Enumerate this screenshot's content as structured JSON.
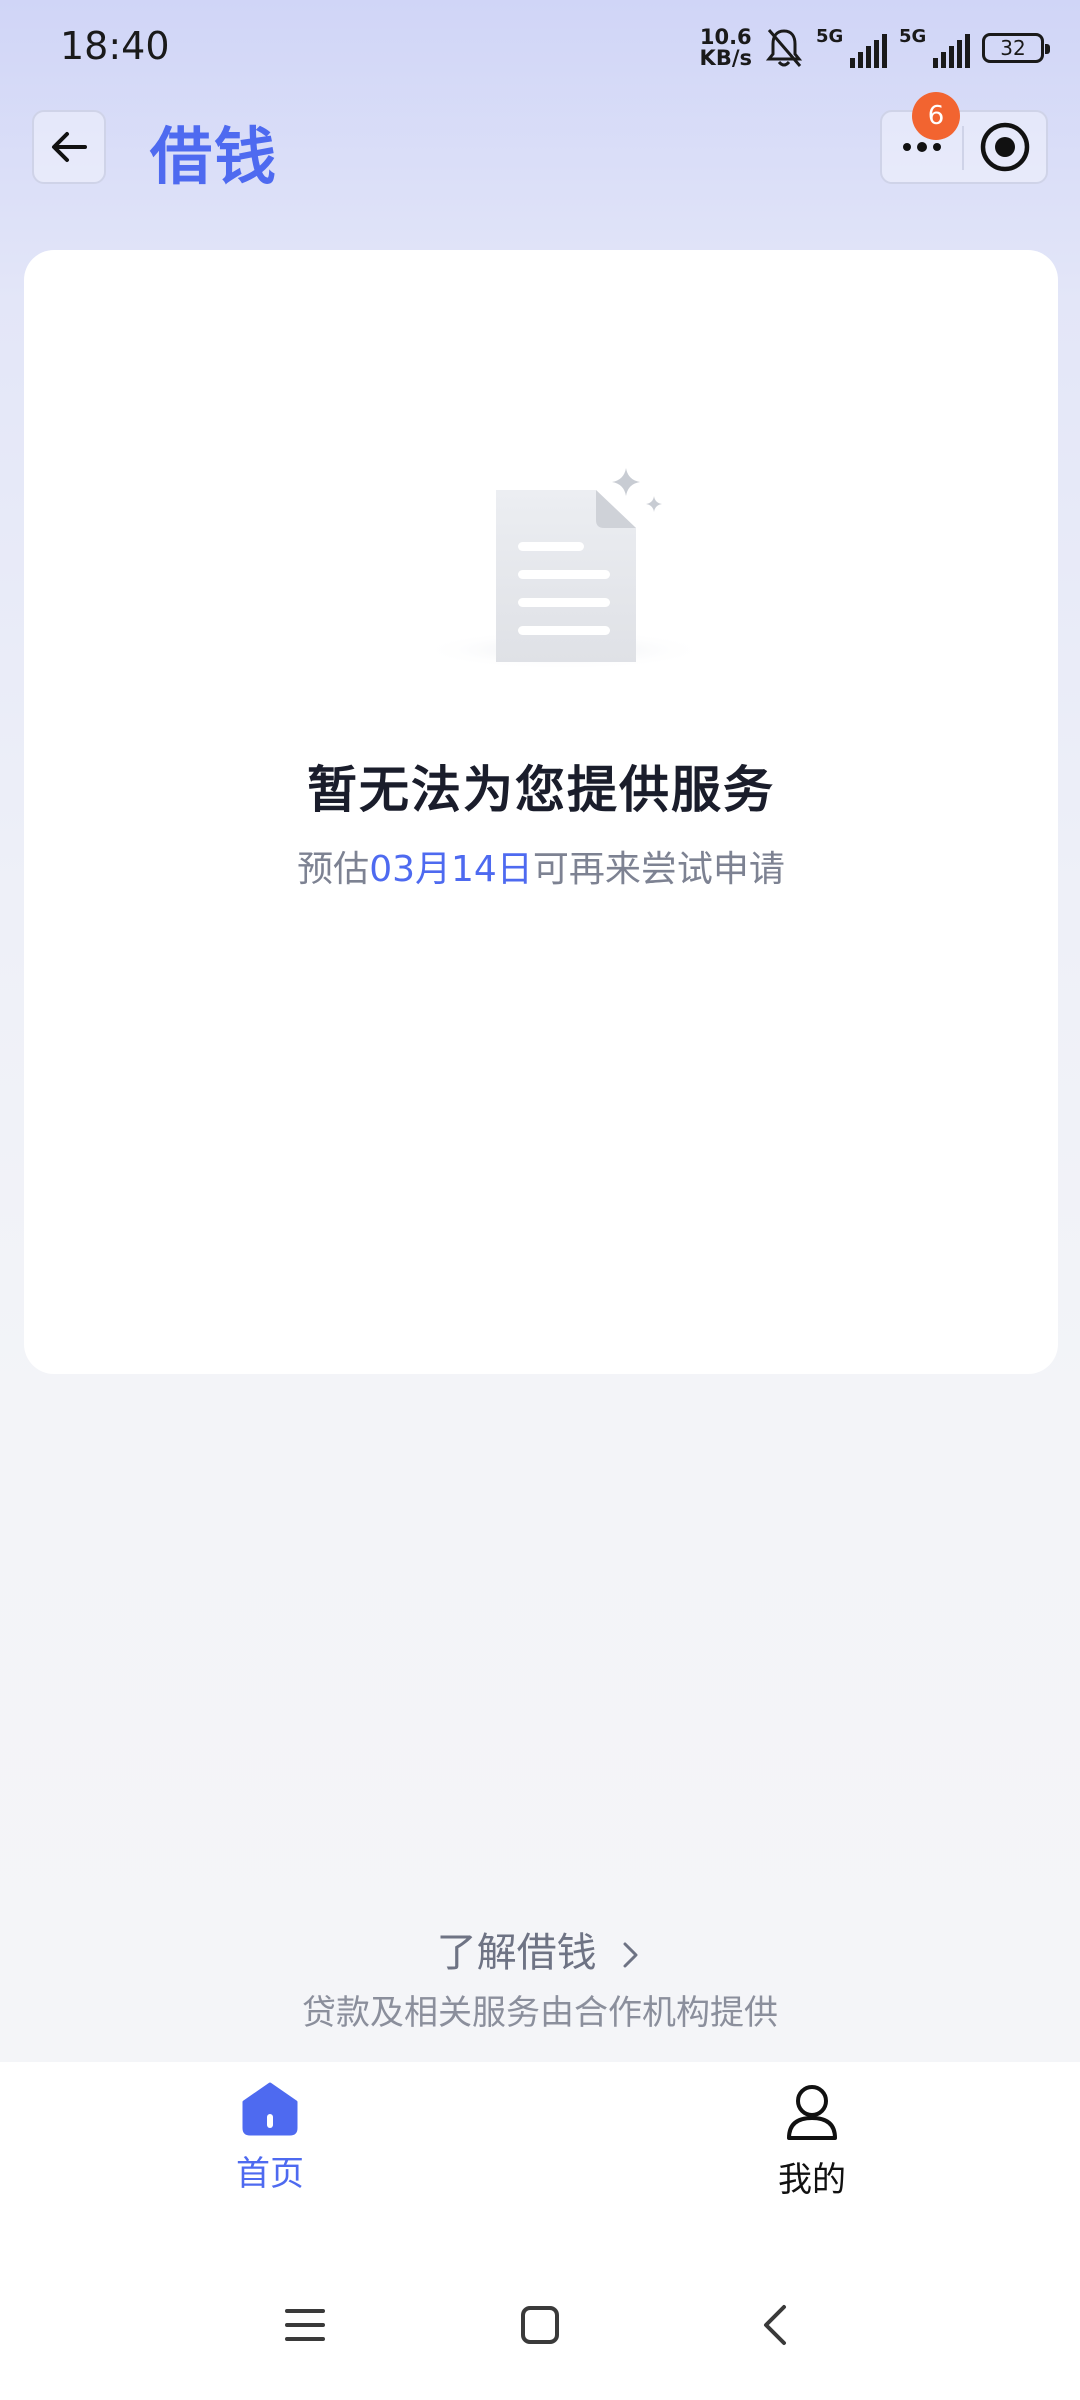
{
  "status_bar": {
    "time": "18:40",
    "net_speed_value": "10.6",
    "net_speed_unit": "KB/s",
    "sim1_tag": "5G",
    "sim2_tag": "5G",
    "battery": "32",
    "icons": [
      "bell-muted-icon",
      "signal-icon",
      "signal-icon",
      "battery-icon"
    ]
  },
  "header": {
    "title": "借钱",
    "back_icon": "arrow-left-icon",
    "more_icon": "more-dots-icon",
    "close_icon": "target-circle-icon",
    "badge_count": "6",
    "accent_color": "#4e6af0",
    "badge_color": "#f26430"
  },
  "main": {
    "illustration_icon": "empty-document-icon",
    "title": "暂无法为您提供服务",
    "desc_prefix": "预估",
    "desc_date": "03月14日",
    "desc_suffix": "可再来尝试申请"
  },
  "footer": {
    "learn_link": "了解借钱",
    "learn_icon": "chevron-right-icon",
    "provider_note": "贷款及相关服务由合作机构提供"
  },
  "tabs": [
    {
      "label": "首页",
      "icon": "home-icon",
      "active": true
    },
    {
      "label": "我的",
      "icon": "user-icon",
      "active": false
    }
  ],
  "nav_bar": {
    "icons": [
      "menu-icon",
      "home-square-icon",
      "back-chevron-icon"
    ]
  }
}
